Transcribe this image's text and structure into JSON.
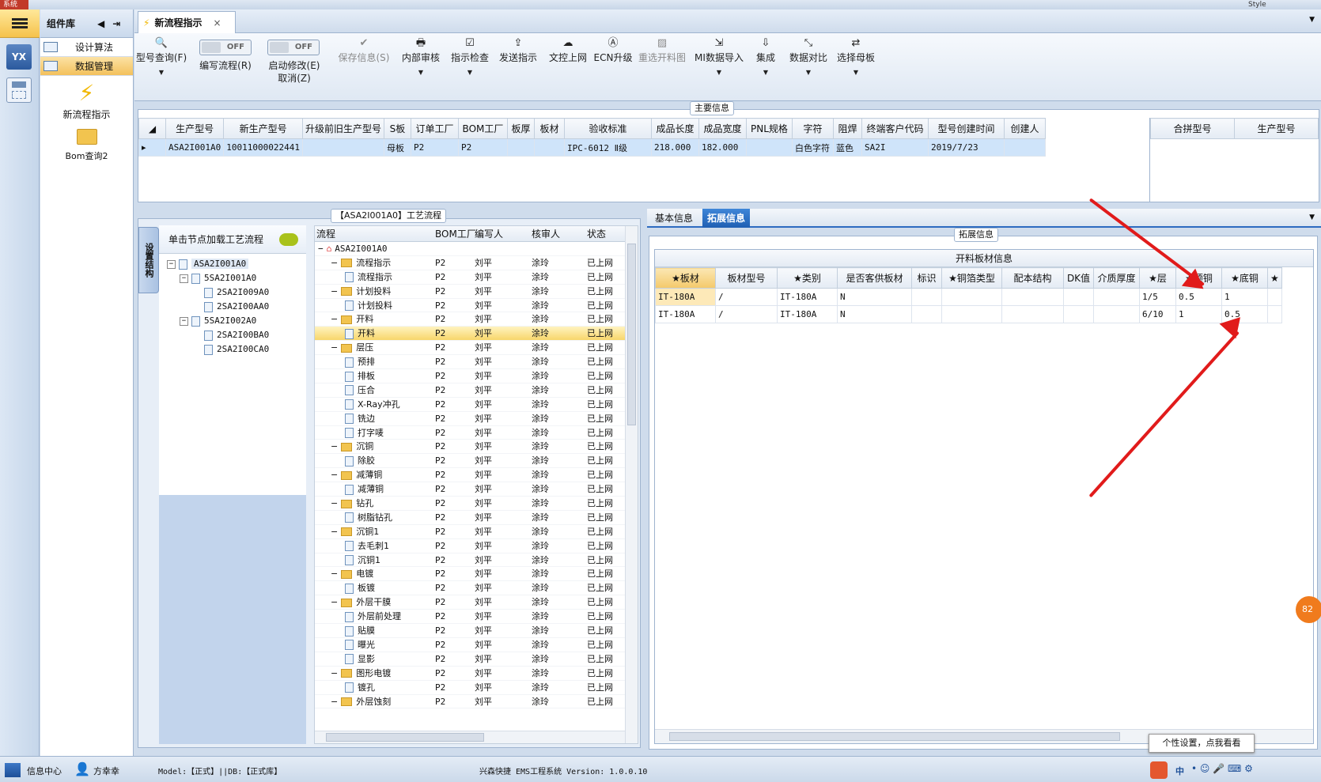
{
  "system": {
    "label": "系统",
    "style": "Style"
  },
  "sidebar": {
    "logo": "YX"
  },
  "components": {
    "title": "组件库",
    "items": [
      {
        "label": "设计算法"
      },
      {
        "label": "数据管理"
      }
    ],
    "tools": [
      {
        "label": "新流程指示"
      },
      {
        "label": "Bom查询2"
      }
    ]
  },
  "tab": {
    "label": "新流程指示",
    "close": "×"
  },
  "toolbar": {
    "buttons": [
      {
        "label": "型号查询(F)"
      },
      {
        "label": "编写流程(R)"
      },
      {
        "label": "启动修改(E)"
      },
      {
        "label": "取消(Z)"
      },
      {
        "label": "保存信息(S)"
      },
      {
        "label": "内部审核"
      },
      {
        "label": "指示检查"
      },
      {
        "label": "发送指示"
      },
      {
        "label": "文控上网"
      },
      {
        "label": "ECN升级"
      },
      {
        "label": "重选开料图"
      },
      {
        "label": "MI数据导入"
      },
      {
        "label": "集成"
      },
      {
        "label": "数据对比"
      },
      {
        "label": "选择母板"
      }
    ],
    "toggle_off": "OFF"
  },
  "main_info": {
    "caption": "主要信息",
    "columns": [
      "生产型号",
      "新生产型号",
      "升级前旧生产型号",
      "S板",
      "订单工厂",
      "BOM工厂",
      "板厚",
      "板材",
      "验收标准",
      "成品长度",
      "成品宽度",
      "PNL规格",
      "字符",
      "阻焊",
      "终端客户代码",
      "型号创建时间",
      "创建人"
    ],
    "rows": [
      [
        "ASA2I001A0",
        "10011000022441",
        "",
        "母板",
        "P2",
        "P2",
        "",
        "",
        "IPC-6012 Ⅱ级",
        "218.000",
        "182.000",
        "",
        "白色字符",
        "蓝色",
        "SA2I",
        "2019/7/23",
        ""
      ]
    ],
    "side_columns": [
      "合拼型号",
      "生产型号"
    ]
  },
  "process": {
    "caption": "【ASA2I001A0】工艺流程",
    "side_tab": "设置结构",
    "hint": "单击节点加载工艺流程",
    "tree": [
      {
        "label": "ASA2I001A0"
      },
      {
        "label": "5SA2I001A0"
      },
      {
        "label": "2SA2I009A0"
      },
      {
        "label": "2SA2I00AA0"
      },
      {
        "label": "5SA2I002A0"
      },
      {
        "label": "2SA2I00BA0"
      },
      {
        "label": "2SA2I00CA0"
      }
    ],
    "flow_columns": [
      "流程",
      "BOM工厂",
      "编写人",
      "核审人",
      "状态"
    ],
    "flow_root": "ASA2I001A0",
    "flow_rows": [
      {
        "name": "流程指示",
        "folder": true
      },
      {
        "name": "流程指示",
        "folder": false
      },
      {
        "name": "计划投料",
        "folder": true
      },
      {
        "name": "计划投料",
        "folder": false
      },
      {
        "name": "开料",
        "folder": true
      },
      {
        "name": "开料",
        "folder": false
      },
      {
        "name": "层压",
        "folder": true
      },
      {
        "name": "预排",
        "folder": false
      },
      {
        "name": "排板",
        "folder": false
      },
      {
        "name": "压合",
        "folder": false
      },
      {
        "name": "X-Ray冲孔",
        "folder": false
      },
      {
        "name": "铣边",
        "folder": false
      },
      {
        "name": "打字唛",
        "folder": false
      },
      {
        "name": "沉铜",
        "folder": true
      },
      {
        "name": "除胶",
        "folder": false
      },
      {
        "name": "减薄铜",
        "folder": true
      },
      {
        "name": "减薄铜",
        "folder": false
      },
      {
        "name": "钻孔",
        "folder": true
      },
      {
        "name": "树脂钻孔",
        "folder": false
      },
      {
        "name": "沉铜1",
        "folder": true
      },
      {
        "name": "去毛刺1",
        "folder": false
      },
      {
        "name": "沉铜1",
        "folder": false
      },
      {
        "name": "电镀",
        "folder": true
      },
      {
        "name": "板镀",
        "folder": false
      },
      {
        "name": "外层干膜",
        "folder": true
      },
      {
        "name": "外层前处理",
        "folder": false
      },
      {
        "name": "贴膜",
        "folder": false
      },
      {
        "name": "曝光",
        "folder": false
      },
      {
        "name": "显影",
        "folder": false
      },
      {
        "name": "图形电镀",
        "folder": true
      },
      {
        "name": "镀孔",
        "folder": false
      },
      {
        "name": "外层蚀刻",
        "folder": true
      }
    ],
    "flow_bom": "P2",
    "flow_writer": "刘平",
    "flow_reviewer": "涂玲",
    "flow_status": "已上网"
  },
  "extend": {
    "tabs": [
      "基本信息",
      "拓展信息"
    ],
    "caption": "拓展信息",
    "title": "开料板材信息",
    "columns": [
      "★板材",
      "板材型号",
      "★类别",
      "是否客供板材",
      "标识",
      "★铜箔类型",
      "配本结构",
      "DK值",
      "介质厚度",
      "★层",
      "★顶铜",
      "★底铜",
      "★"
    ],
    "rows": [
      [
        "IT-180A",
        "/",
        "IT-180A",
        "N",
        "",
        "",
        "",
        "",
        "",
        "1/5",
        "0.5",
        "1",
        ""
      ],
      [
        "IT-180A",
        "/",
        "IT-180A",
        "N",
        "",
        "",
        "",
        "",
        "",
        "6/10",
        "1",
        "0.5",
        ""
      ]
    ],
    "float_badge": "82",
    "tooltip": "个性设置，点我看看"
  },
  "statusbar": {
    "info_center": "信息中心",
    "user": "方幸幸",
    "model": "Model:【正式】||DB:【正式库】",
    "app": "兴森快捷 EMS工程系统 Version: 1.0.0.10",
    "ime": "中"
  },
  "colors": {
    "accent": "#f3c15c",
    "selected_tab": "#1f5fb3",
    "annotation_arrow": "#e11b1b"
  }
}
